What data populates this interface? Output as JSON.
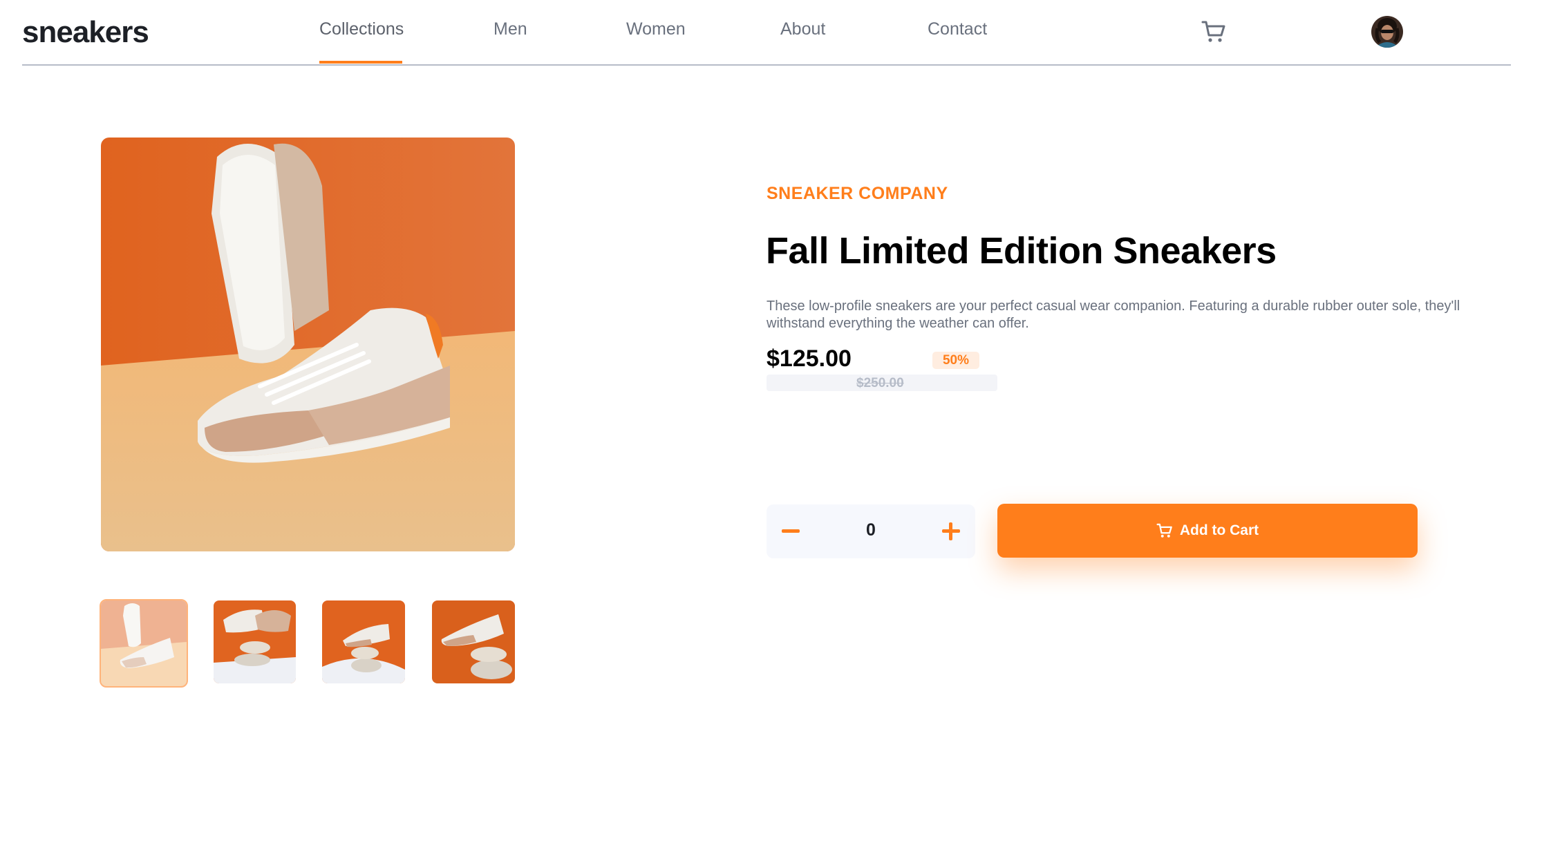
{
  "header": {
    "logo": "sneakers",
    "nav": [
      {
        "label": "Collections",
        "active": true
      },
      {
        "label": "Men"
      },
      {
        "label": "Women"
      },
      {
        "label": "About"
      },
      {
        "label": "Contact"
      }
    ],
    "cart_icon": "cart-icon",
    "avatar": "user-avatar"
  },
  "gallery": {
    "thumbnails": [
      "thumbnail-1",
      "thumbnail-2",
      "thumbnail-3",
      "thumbnail-4"
    ],
    "selected": 1
  },
  "product": {
    "company": "SNEAKER COMPANY",
    "title": "Fall Limited Edition Sneakers",
    "description": "These low-profile sneakers are your perfect casual wear companion. Featuring a durable rubber outer sole, they'll withstand everything the weather can offer.",
    "price": "$125.00",
    "discount": "50%",
    "old_price": "$250.00"
  },
  "cart": {
    "quantity": "0",
    "add_label": "Add to Cart"
  },
  "colors": {
    "accent": "#ff7e1b",
    "accent_light": "#ffede0",
    "text_dark": "#1d2026",
    "text_grey": "#69707d"
  }
}
